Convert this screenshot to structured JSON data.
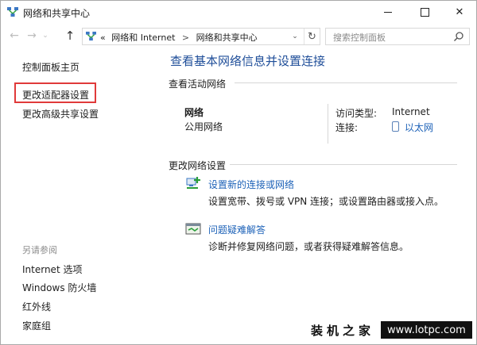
{
  "window": {
    "title": "网络和共享中心"
  },
  "address": {
    "prefix": "«",
    "crumbs": [
      "网络和 Internet",
      "网络和共享中心"
    ],
    "separator": ">",
    "search_placeholder": "搜索控制面板"
  },
  "left": {
    "home": "控制面板主页",
    "adapter": "更改适配器设置",
    "advanced": "更改高级共享设置",
    "see_also_title": "另请参阅",
    "see_also": [
      "Internet 选项",
      "Windows 防火墙",
      "红外线",
      "家庭组"
    ]
  },
  "main": {
    "title": "查看基本网络信息并设置连接",
    "active_heading": "查看活动网络",
    "network_name": "网络",
    "network_type": "公用网络",
    "access_label": "访问类型:",
    "access_value": "Internet",
    "conn_label": "连接:",
    "conn_value": "以太网",
    "change_heading": "更改网络设置",
    "tasks": [
      {
        "link": "设置新的连接或网络",
        "desc": "设置宽带、拨号或 VPN 连接；或设置路由器或接入点。",
        "icon": "network-setup-icon"
      },
      {
        "link": "问题疑难解答",
        "desc": "诊断并修复网络问题，或者获得疑难解答信息。",
        "icon": "troubleshoot-icon"
      }
    ]
  },
  "watermark": {
    "cn": "装机之家",
    "url": "www.lotpc.com"
  },
  "colors": {
    "link": "#1d62b8",
    "title": "#1f4e99",
    "highlight": "#e03a3a"
  }
}
